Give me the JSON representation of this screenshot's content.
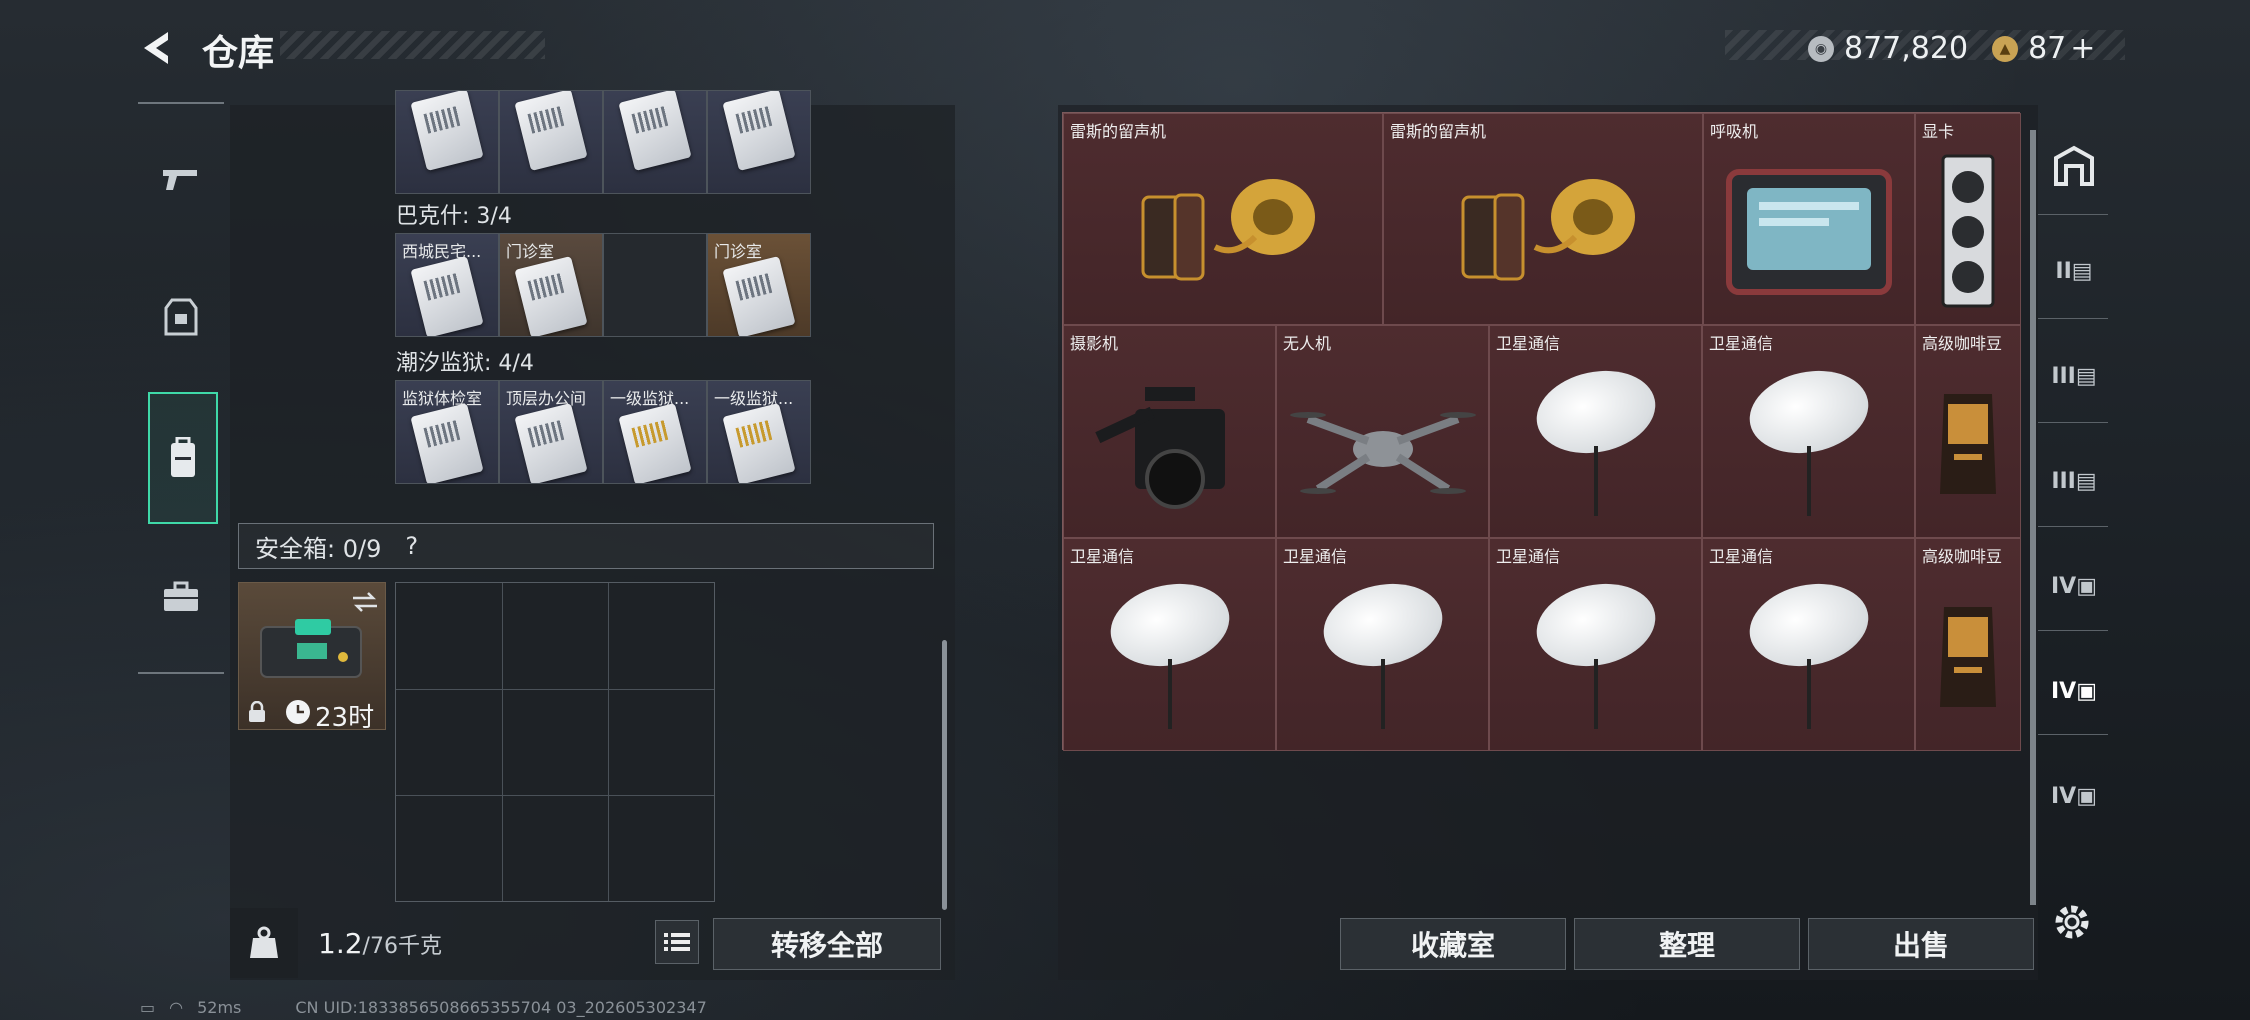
{
  "header": {
    "title": "仓库"
  },
  "currency": {
    "silver": "877,820",
    "gold": "87",
    "gold_plus": "+"
  },
  "left_tabs": [
    {
      "name": "weapon"
    },
    {
      "name": "armor"
    },
    {
      "name": "backpack"
    },
    {
      "name": "case"
    }
  ],
  "groups": [
    {
      "title": "",
      "slots": [
        {
          "label": ""
        },
        {
          "label": ""
        },
        {
          "label": ""
        },
        {
          "label": ""
        }
      ]
    },
    {
      "title": "巴克什: 3/4",
      "slots": [
        {
          "label": "西城民宅..."
        },
        {
          "label": "门诊室"
        },
        {
          "label": ""
        },
        {
          "label": "门诊室"
        }
      ]
    },
    {
      "title": "潮汐监狱: 4/4",
      "slots": [
        {
          "label": "监狱体检室"
        },
        {
          "label": "顶层办公间"
        },
        {
          "label": "一级监狱..."
        },
        {
          "label": "一级监狱..."
        }
      ]
    }
  ],
  "safe_box": {
    "label": "安全箱: 0/9",
    "help": "?",
    "timer": "23时"
  },
  "weight": {
    "current": "1.2",
    "max": "/76千克"
  },
  "buttons": {
    "transfer_all": "转移全部",
    "collection": "收藏室",
    "organize": "整理",
    "sell": "出售"
  },
  "items": [
    {
      "label": "雷斯的留声机",
      "icon": "gramophone"
    },
    {
      "label": "雷斯的留声机",
      "icon": "gramophone"
    },
    {
      "label": "呼吸机",
      "icon": "ventilator"
    },
    {
      "label": "显卡",
      "icon": "gpu"
    },
    {
      "label": "摄影机",
      "icon": "camera"
    },
    {
      "label": "无人机",
      "icon": "drone"
    },
    {
      "label": "卫星通信",
      "icon": "satellite-dish"
    },
    {
      "label": "卫星通信",
      "icon": "satellite-dish"
    },
    {
      "label": "高级咖啡豆",
      "icon": "coffee-bag"
    },
    {
      "label": "卫星通信",
      "icon": "satellite-dish"
    },
    {
      "label": "卫星通信",
      "icon": "satellite-dish"
    },
    {
      "label": "卫星通信",
      "icon": "satellite-dish"
    },
    {
      "label": "卫星通信",
      "icon": "satellite-dish"
    },
    {
      "label": "高级咖啡豆",
      "icon": "coffee-bag"
    }
  ],
  "right_nav": [
    "II",
    "III",
    "III",
    "IV",
    "IV",
    "IV"
  ],
  "status": {
    "ping": "52ms",
    "uid": "CN UID:1833856508665355704 03_202605302347"
  }
}
